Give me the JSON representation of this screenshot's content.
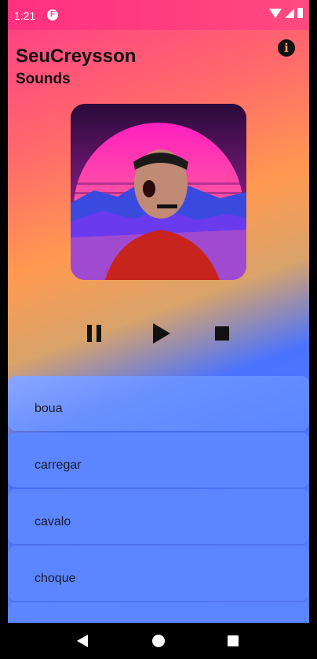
{
  "status_bar": {
    "time": "1:21",
    "app_icon": "F"
  },
  "header": {
    "title": "SeuCreysson",
    "subtitle": "Sounds",
    "info_icon": "i"
  },
  "album_art": {
    "description_icon": "synthwave-sunset-portrait"
  },
  "controls": {
    "pause_icon": "pause-icon",
    "play_icon": "play-icon",
    "stop_icon": "stop-icon"
  },
  "sounds": [
    {
      "label": "boua"
    },
    {
      "label": "carregar"
    },
    {
      "label": "cavalo"
    },
    {
      "label": "choque"
    },
    {
      "label": ""
    }
  ],
  "colors": {
    "accent_pink": "#ff3a8a",
    "list_blue": "#5b86ff"
  }
}
